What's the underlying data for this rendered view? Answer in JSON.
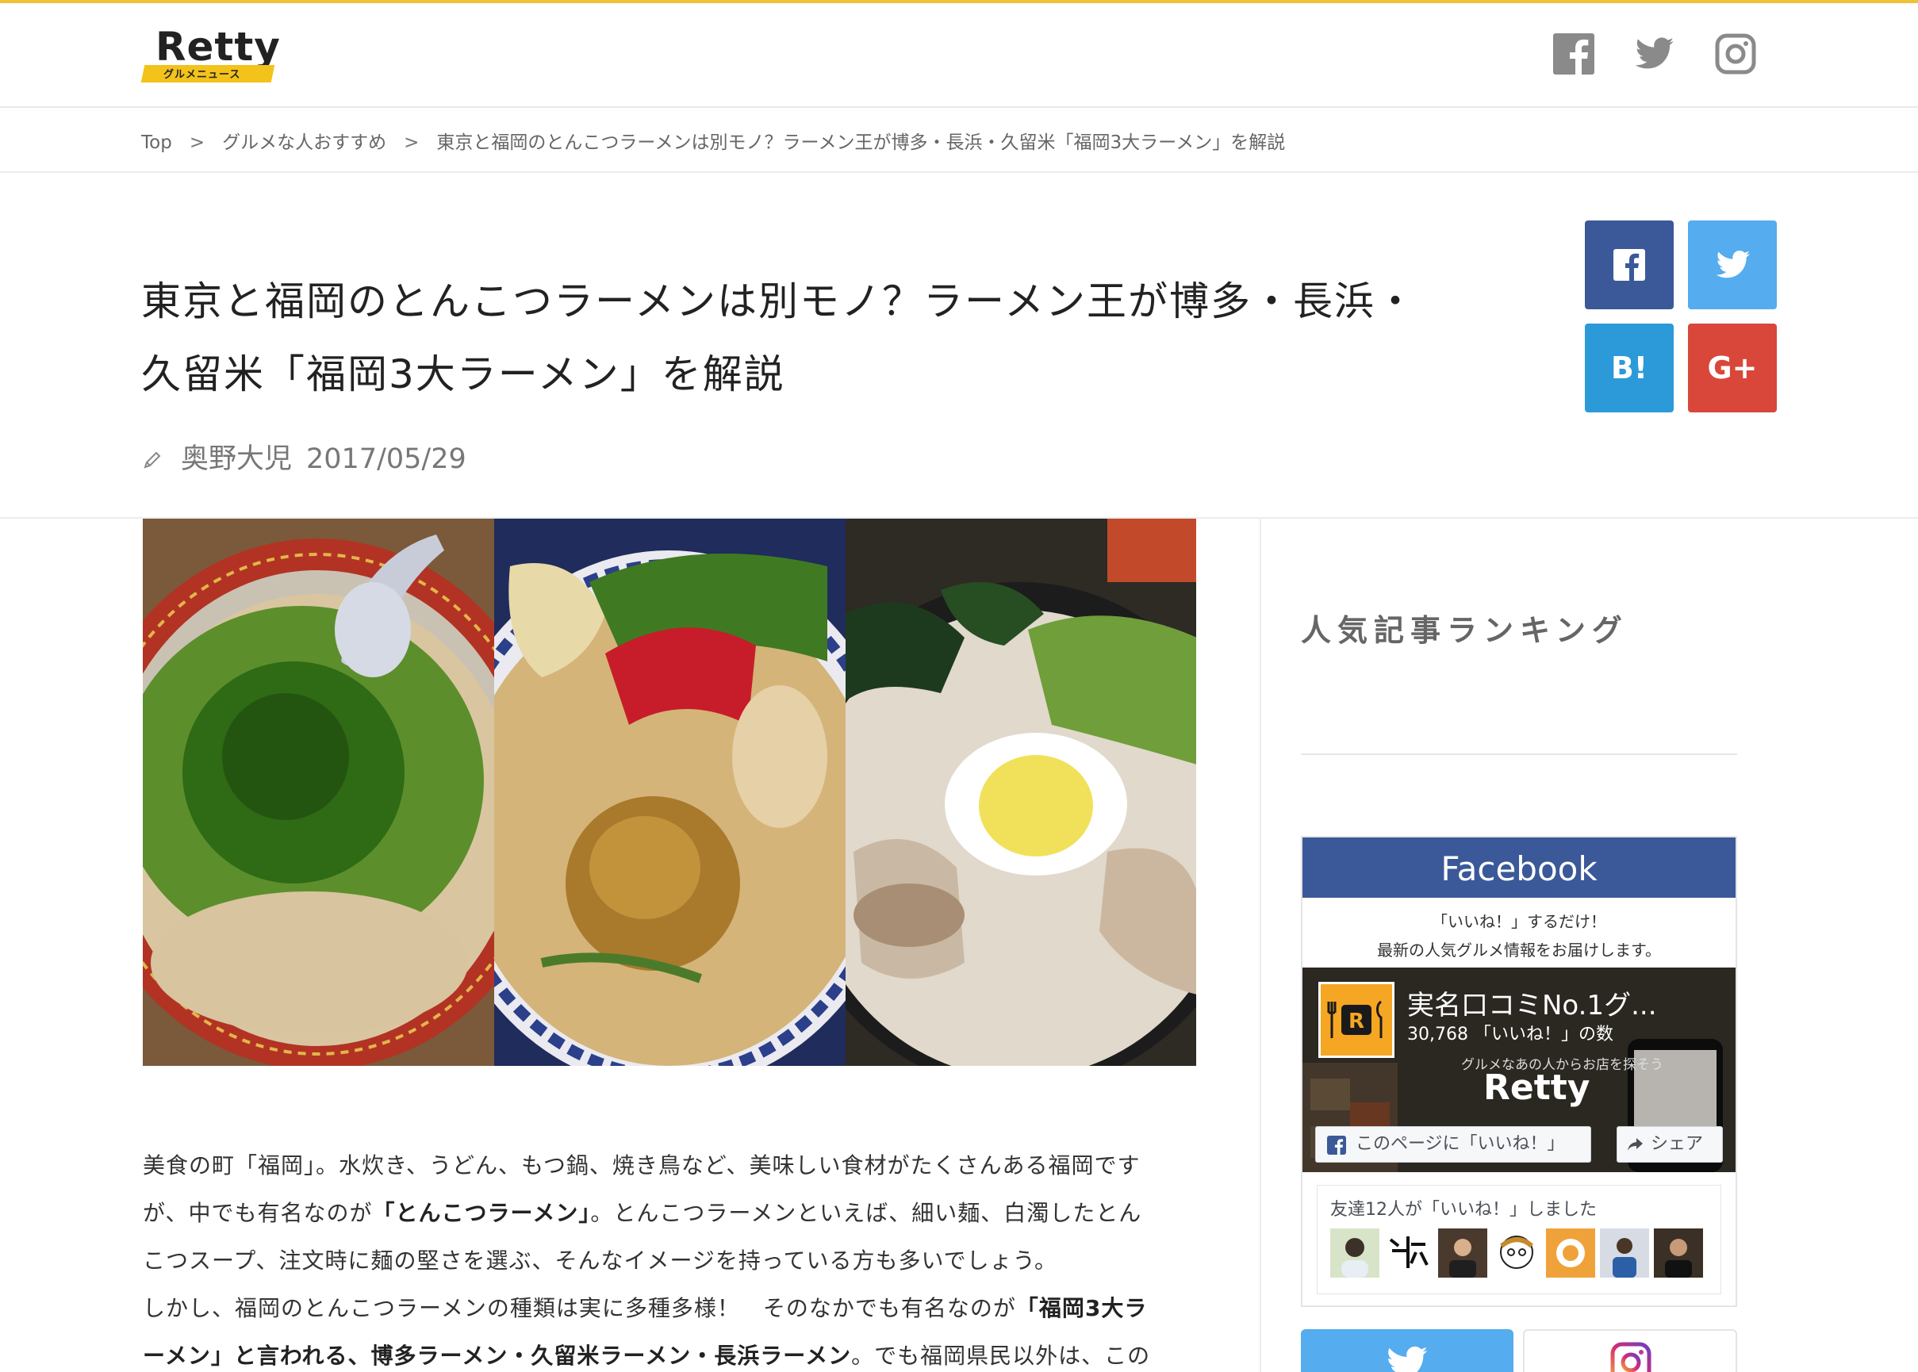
{
  "header": {
    "logo_text": "Retty",
    "logo_sub": "グルメニュース",
    "social_icons": [
      "facebook-icon",
      "twitter-icon",
      "instagram-icon"
    ]
  },
  "breadcrumb": {
    "items": [
      "Top",
      "グルメな人おすすめ",
      "東京と福岡のとんこつラーメンは別モノ？ラーメン王が博多・長浜・久留米「福岡3大ラーメン」を解説"
    ],
    "separator": ">"
  },
  "article": {
    "title_line1": "東京と福岡のとんこつラーメンは別モノ？ラーメン王が博多・長浜・",
    "title_line2": "久留米「福岡3大ラーメン」を解説",
    "author": "奥野大児",
    "date": "2017/05/29",
    "body": {
      "p1_a": "美食の町「福岡」。水炊き、うどん、もつ鍋、焼き鳥など、美味しい食材がたくさんある福岡です",
      "p1_b": "が、中でも有名なのが",
      "p1_bold": "「とんこつラーメン」",
      "p1_c": "。とんこつラーメンといえば、細い麺、白濁したとん",
      "p1_d": "こつスープ、注文時に麺の堅さを選ぶ、そんなイメージを持っている方も多いでしょう。",
      "p2_a": "しかし、福岡のとんこつラーメンの種類は実に多種多様！　そのなかでも有名なのが",
      "p2_bold1": "「福岡3大ラ",
      "p2_bold2": "ーメン」と言われる、博多ラーメン・久留米ラーメン・長浜ラーメン",
      "p2_c": "。でも福岡県民以外は、この"
    }
  },
  "share": {
    "buttons": [
      {
        "name": "facebook",
        "color": "#3b5998"
      },
      {
        "name": "twitter",
        "color": "#55acee"
      },
      {
        "name": "hatena",
        "label": "B!",
        "color": "#2c9ad9"
      },
      {
        "name": "googleplus",
        "label": "G+",
        "color": "#d9473a"
      }
    ]
  },
  "sidebar": {
    "ranking_heading": "人気記事ランキング",
    "facebook": {
      "heading": "Facebook",
      "desc_line1": "「いいね！」するだけ！",
      "desc_line2": "最新の人気グルメ情報をお届けします。",
      "page_name": "実名口コミNo.1グ...",
      "likes_count": "30,768",
      "likes_label": "「いいね！」の数",
      "cover_tagline": "グルメなあの人からお店を探そう",
      "cover_brand": "Retty",
      "like_button": "このページに「いいね！」",
      "share_button": "シェア",
      "friends_text": "友達12人が「いいね！」しました"
    }
  },
  "colors": {
    "accent": "#f0c23a",
    "facebook": "#3b5998",
    "twitter": "#55acee",
    "hatena": "#2c9ad9",
    "googleplus": "#d9473a"
  }
}
